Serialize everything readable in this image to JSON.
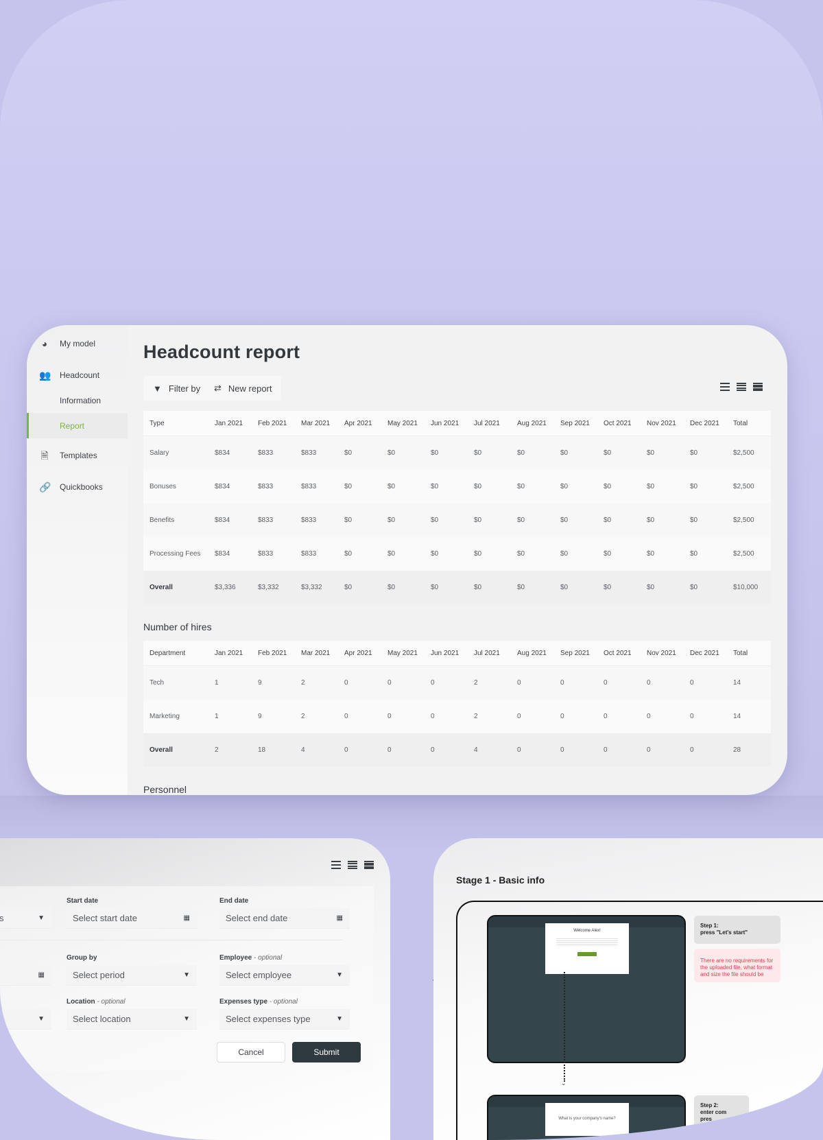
{
  "sidebar": {
    "items": [
      {
        "label": "My model",
        "icon": "pie-chart-icon"
      },
      {
        "label": "Headcount",
        "icon": "users-icon"
      },
      {
        "label": "Information"
      },
      {
        "label": "Report",
        "active": true
      },
      {
        "label": "Templates",
        "icon": "document-icon"
      },
      {
        "label": "Quickbooks",
        "icon": "link-icon"
      }
    ]
  },
  "colors": {
    "accent": "#7cb342",
    "dark_button": "#2f3a40",
    "note_red": "#e0404f"
  },
  "header": {
    "title": "Headcount report",
    "filter_label": "Filter by",
    "new_report_label": "New report"
  },
  "months": [
    "Jan 2021",
    "Feb 2021",
    "Mar 2021",
    "Apr 2021",
    "May 2021",
    "Jun 2021",
    "Jul 2021",
    "Aug 2021",
    "Sep 2021",
    "Oct 2021",
    "Nov 2021",
    "Dec 2021"
  ],
  "cost_table": {
    "first_header": "Type",
    "total_header": "Total",
    "rows": [
      {
        "label": "Salary",
        "values": [
          "$834",
          "$833",
          "$833",
          "$0",
          "$0",
          "$0",
          "$0",
          "$0",
          "$0",
          "$0",
          "$0",
          "$0"
        ],
        "total": "$2,500"
      },
      {
        "label": "Bonuses",
        "values": [
          "$834",
          "$833",
          "$833",
          "$0",
          "$0",
          "$0",
          "$0",
          "$0",
          "$0",
          "$0",
          "$0",
          "$0"
        ],
        "total": "$2,500"
      },
      {
        "label": "Benefits",
        "values": [
          "$834",
          "$833",
          "$833",
          "$0",
          "$0",
          "$0",
          "$0",
          "$0",
          "$0",
          "$0",
          "$0",
          "$0"
        ],
        "total": "$2,500"
      },
      {
        "label": "Processing Fees",
        "values": [
          "$834",
          "$833",
          "$833",
          "$0",
          "$0",
          "$0",
          "$0",
          "$0",
          "$0",
          "$0",
          "$0",
          "$0"
        ],
        "total": "$2,500"
      },
      {
        "label": "Overall",
        "overall": true,
        "values": [
          "$3,336",
          "$3,332",
          "$3,332",
          "$0",
          "$0",
          "$0",
          "$0",
          "$0",
          "$0",
          "$0",
          "$0",
          "$0"
        ],
        "total": "$10,000"
      }
    ]
  },
  "hires": {
    "title": "Number of hires",
    "first_header": "Department",
    "total_header": "Total",
    "rows": [
      {
        "label": "Tech",
        "values": [
          "1",
          "9",
          "2",
          "0",
          "0",
          "0",
          "2",
          "0",
          "0",
          "0",
          "0",
          "0"
        ],
        "total": "14"
      },
      {
        "label": "Marketing",
        "values": [
          "1",
          "9",
          "2",
          "0",
          "0",
          "0",
          "2",
          "0",
          "0",
          "0",
          "0",
          "0"
        ],
        "total": "14"
      },
      {
        "label": "Overall",
        "overall": true,
        "values": [
          "2",
          "18",
          "4",
          "0",
          "0",
          "0",
          "4",
          "0",
          "0",
          "0",
          "0",
          "0"
        ],
        "total": "28"
      }
    ]
  },
  "personnel_title": "Personnel",
  "form": {
    "partial_value": "s",
    "start_date": {
      "label": "Start date",
      "placeholder": "Select start date"
    },
    "end_date": {
      "label": "End date",
      "placeholder": "Select end date"
    },
    "group_by": {
      "label": "Group by",
      "placeholder": "Select period"
    },
    "employee": {
      "label": "Employee",
      "optional": "- optional",
      "placeholder": "Select employee"
    },
    "location": {
      "label": "Location",
      "optional": "- optional",
      "placeholder": "Select location"
    },
    "expenses": {
      "label": "Expenses type",
      "optional": "- optional",
      "placeholder": "Select expenses type"
    },
    "cancel": "Cancel",
    "submit": "Submit"
  },
  "flow": {
    "stage_title": "Stage 1 - Basic info",
    "arrow": "···>",
    "screen1_title": "Welcome Alex!",
    "screen2_question": "What is your company's name?",
    "step1": {
      "title": "Step 1:",
      "text": "press \"Let's start\""
    },
    "note": "There are no requirements for the uploaded file, what format and size the file should be",
    "step2": {
      "title": "Step 2:",
      "line1": "enter com",
      "line2": "pres"
    }
  }
}
